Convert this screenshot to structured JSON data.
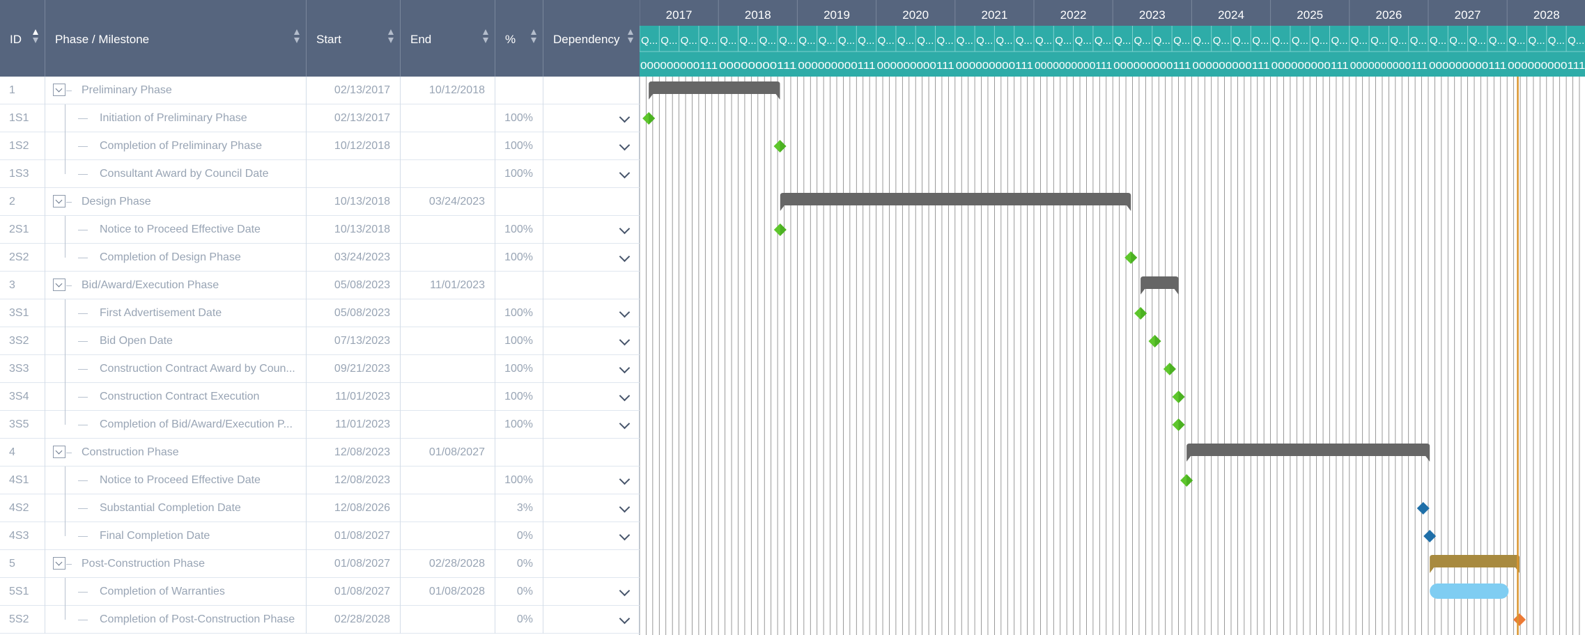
{
  "columns": {
    "id": "ID",
    "name": "Phase / Milestone",
    "start": "Start",
    "end": "End",
    "pct": "%",
    "dep": "Dependency"
  },
  "timeline": {
    "years": [
      "2017",
      "2018",
      "2019",
      "2020",
      "2021",
      "2022",
      "2023",
      "2024",
      "2025",
      "2026",
      "2027",
      "2028"
    ],
    "quarter_label": "Q...",
    "month_strip": [
      "000000000111",
      "00000000111",
      "000000000111",
      "000000000111",
      "000000000111",
      "0000000000111",
      "000000000111",
      "000000000111",
      "000000000111",
      "0000000000111",
      "000000000111",
      "000000000111"
    ],
    "colors": {
      "header_bg": "#56657e",
      "timescale_bg": "#2eaca8",
      "phase_bar": "#666666",
      "post_bar": "#a88a3f",
      "light_bar": "#7fcdf2",
      "green_milestone": "#5ec62c",
      "blue_milestone": "#1f6fa8",
      "orange_milestone": "#ec7a35",
      "today_line": "#d9952e"
    }
  },
  "rows": [
    {
      "id": "1",
      "name": "Preliminary Phase",
      "start": "02/13/2017",
      "end": "10/12/2018",
      "pct": "",
      "level": 0,
      "dep": false
    },
    {
      "id": "1S1",
      "name": "Initiation of Preliminary Phase",
      "start": "02/13/2017",
      "end": "",
      "pct": "100%",
      "level": 1,
      "dep": true
    },
    {
      "id": "1S2",
      "name": "Completion of Preliminary Phase",
      "start": "10/12/2018",
      "end": "",
      "pct": "100%",
      "level": 1,
      "dep": true
    },
    {
      "id": "1S3",
      "name": "Consultant Award by Council Date",
      "start": "",
      "end": "",
      "pct": "100%",
      "level": 1,
      "dep": true
    },
    {
      "id": "2",
      "name": "Design Phase",
      "start": "10/13/2018",
      "end": "03/24/2023",
      "pct": "",
      "level": 0,
      "dep": false
    },
    {
      "id": "2S1",
      "name": "Notice to Proceed Effective Date",
      "start": "10/13/2018",
      "end": "",
      "pct": "100%",
      "level": 1,
      "dep": true
    },
    {
      "id": "2S2",
      "name": "Completion of Design Phase",
      "start": "03/24/2023",
      "end": "",
      "pct": "100%",
      "level": 1,
      "dep": true
    },
    {
      "id": "3",
      "name": "Bid/Award/Execution Phase",
      "start": "05/08/2023",
      "end": "11/01/2023",
      "pct": "",
      "level": 0,
      "dep": false
    },
    {
      "id": "3S1",
      "name": "First Advertisement Date",
      "start": "05/08/2023",
      "end": "",
      "pct": "100%",
      "level": 1,
      "dep": true
    },
    {
      "id": "3S2",
      "name": "Bid Open Date",
      "start": "07/13/2023",
      "end": "",
      "pct": "100%",
      "level": 1,
      "dep": true
    },
    {
      "id": "3S3",
      "name": "Construction Contract Award by Coun...",
      "start": "09/21/2023",
      "end": "",
      "pct": "100%",
      "level": 1,
      "dep": true
    },
    {
      "id": "3S4",
      "name": "Construction Contract Execution",
      "start": "11/01/2023",
      "end": "",
      "pct": "100%",
      "level": 1,
      "dep": true
    },
    {
      "id": "3S5",
      "name": "Completion of Bid/Award/Execution P...",
      "start": "11/01/2023",
      "end": "",
      "pct": "100%",
      "level": 1,
      "dep": true
    },
    {
      "id": "4",
      "name": "Construction Phase",
      "start": "12/08/2023",
      "end": "01/08/2027",
      "pct": "",
      "level": 0,
      "dep": false
    },
    {
      "id": "4S1",
      "name": "Notice to Proceed Effective Date",
      "start": "12/08/2023",
      "end": "",
      "pct": "100%",
      "level": 1,
      "dep": true
    },
    {
      "id": "4S2",
      "name": "Substantial Completion Date",
      "start": "12/08/2026",
      "end": "",
      "pct": "3%",
      "level": 1,
      "dep": true
    },
    {
      "id": "4S3",
      "name": "Final Completion Date",
      "start": "01/08/2027",
      "end": "",
      "pct": "0%",
      "level": 1,
      "dep": true
    },
    {
      "id": "5",
      "name": "Post-Construction Phase",
      "start": "01/08/2027",
      "end": "02/28/2028",
      "pct": "0%",
      "level": 0,
      "dep": false
    },
    {
      "id": "5S1",
      "name": "Completion of Warranties",
      "start": "01/08/2027",
      "end": "01/08/2028",
      "pct": "0%",
      "level": 1,
      "dep": true
    },
    {
      "id": "5S2",
      "name": "Completion of Post-Construction Phase",
      "start": "02/28/2028",
      "end": "",
      "pct": "0%",
      "level": 1,
      "dep": true
    }
  ]
}
